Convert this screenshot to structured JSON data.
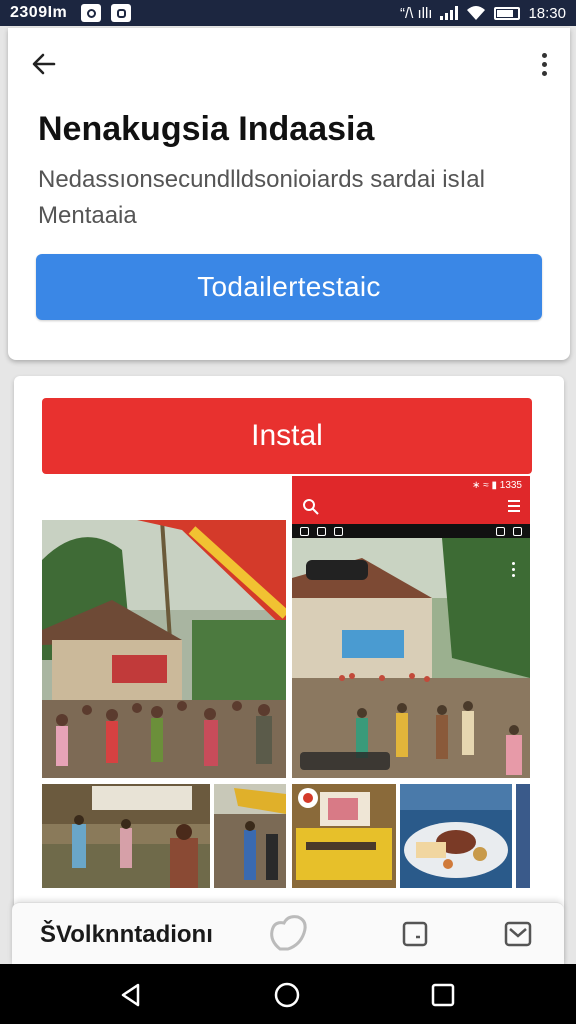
{
  "status_bar": {
    "left_text": "2309Im",
    "right_text": "“/\\ ıllı",
    "time": "18:30"
  },
  "header": {
    "back_icon": "arrow-left-icon",
    "more_icon": "more-vert-icon",
    "title": "Nenakugsia Indaasia",
    "subtitle": "Nedassıonsecundlldsonioiards sardai isIal Mentaaia",
    "primary_button": "Todailertestaic"
  },
  "store": {
    "install_button": "Instal",
    "screenshot_status": "∗ ≈ ▮ 1335",
    "photo_chip": "",
    "photo_tag": ""
  },
  "bottom_tab": {
    "label": "ŠVolknntadionı",
    "icons": [
      "heart-icon",
      "note-icon",
      "mail-icon"
    ]
  },
  "nav": {
    "icons": [
      "back-triangle-icon",
      "home-circle-icon",
      "recents-square-icon"
    ]
  },
  "colors": {
    "status_bar": "#1c2640",
    "primary": "#3a87e6",
    "install": "#e8312f"
  }
}
